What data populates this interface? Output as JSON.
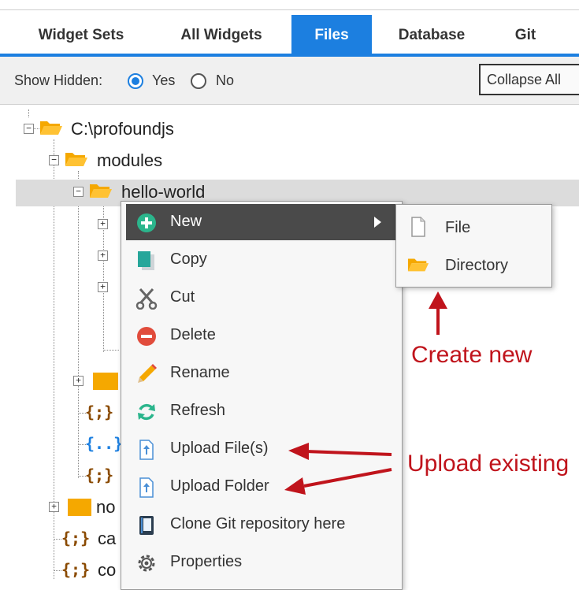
{
  "tabs": [
    {
      "label": "Widget Sets"
    },
    {
      "label": "All Widgets"
    },
    {
      "label": "Files",
      "active": true
    },
    {
      "label": "Database"
    },
    {
      "label": "Git"
    }
  ],
  "toolbar": {
    "show_hidden_label": "Show Hidden:",
    "yes_label": "Yes",
    "no_label": "No",
    "show_hidden_value": "Yes",
    "collapse_label": "Collapse All"
  },
  "tree": {
    "root": "C:\\profoundjs",
    "modules": "modules",
    "selected": "hello-world",
    "partial_no": "no",
    "partial_ca": "ca",
    "partial_co": "co"
  },
  "context_menu": {
    "items": [
      {
        "label": "New",
        "icon": "plus-circle-icon",
        "has_submenu": true,
        "highlighted": true
      },
      {
        "label": "Copy",
        "icon": "copy-icon"
      },
      {
        "label": "Cut",
        "icon": "scissors-icon"
      },
      {
        "label": "Delete",
        "icon": "delete-icon"
      },
      {
        "label": "Rename",
        "icon": "pencil-icon"
      },
      {
        "label": "Refresh",
        "icon": "refresh-icon"
      },
      {
        "label": "Upload File(s)",
        "icon": "upload-file-icon"
      },
      {
        "label": "Upload Folder",
        "icon": "upload-folder-icon"
      },
      {
        "label": "Clone Git repository here",
        "icon": "git-repo-icon"
      },
      {
        "label": "Properties",
        "icon": "gear-icon"
      }
    ]
  },
  "submenu": {
    "items": [
      {
        "label": "File",
        "icon": "file-icon"
      },
      {
        "label": "Directory",
        "icon": "folder-icon"
      }
    ]
  },
  "annotations": {
    "create_new": "Create new",
    "upload_existing": "Upload existing"
  },
  "colors": {
    "accent": "#1c7fe0",
    "annotation": "#c0141c",
    "folder": "#f5a800",
    "menu_highlight": "#4a4a4a"
  }
}
